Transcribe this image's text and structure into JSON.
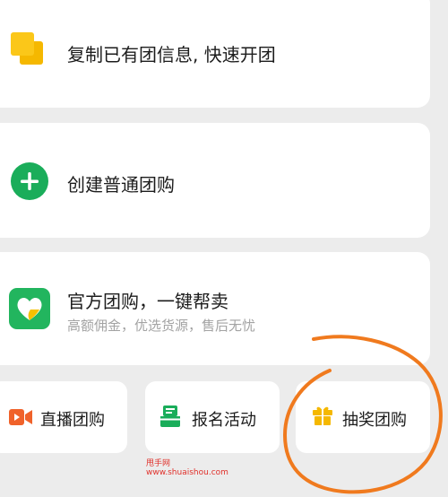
{
  "cards": {
    "copy": {
      "label": "复制已有团信息, 快速开团",
      "icon": "copy-icon",
      "icon_color": "#f5b800"
    },
    "create": {
      "label": "创建普通团购",
      "icon": "plus-icon",
      "icon_color": "#1aad5a"
    },
    "official": {
      "label": "官方团购，一键帮卖",
      "sublabel": "高额佣金，优选货源，售后无忧",
      "icon": "heart-app-icon",
      "icon_color": "#22b55e"
    }
  },
  "actions": [
    {
      "label": "直播团购",
      "icon": "video-camera-icon",
      "icon_color": "#f0622a"
    },
    {
      "label": "报名活动",
      "icon": "register-form-icon",
      "icon_color": "#1aad5a"
    },
    {
      "label": "抽奖团购",
      "icon": "gift-icon",
      "icon_color": "#f5b800"
    }
  ],
  "watermark": {
    "line1": "甩手网",
    "line2": "www.shuaishou.com"
  },
  "annotation": {
    "shape": "hand-drawn-circle",
    "color": "#f07a1e"
  }
}
